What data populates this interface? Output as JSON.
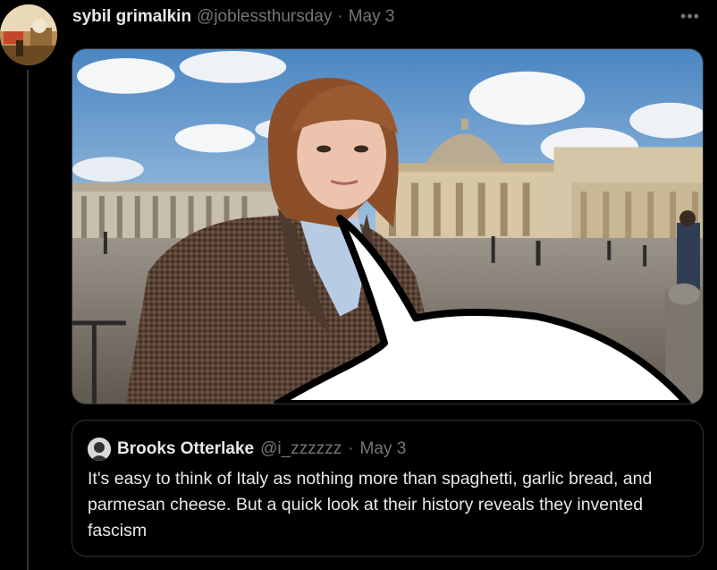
{
  "tweet": {
    "display_name": "sybil grimalkin",
    "handle": "@joblessthursday",
    "separator": "·",
    "date": "May 3",
    "more_icon": "more-horizontal-icon",
    "more_glyph": "•••"
  },
  "quote": {
    "display_name": "Brooks Otterlake",
    "handle": "@i_zzzzzz",
    "separator": "·",
    "date": "May 3",
    "text": "It's easy to think of Italy as nothing more than spaghetti, garlic bread, and parmesan cheese. But a quick look at their history reveals they invented fascism"
  },
  "colors": {
    "background": "#000000",
    "text_primary": "#e7e9ea",
    "text_secondary": "#71767b",
    "border": "#2f3336"
  }
}
